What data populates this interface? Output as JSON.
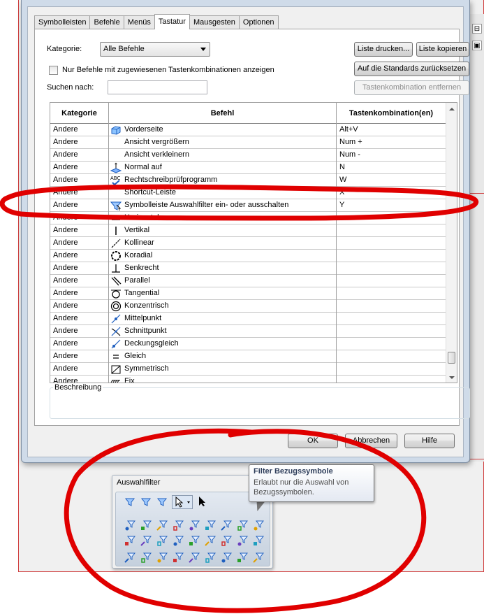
{
  "tabs": [
    {
      "label": "Symbolleisten"
    },
    {
      "label": "Befehle"
    },
    {
      "label": "Menüs"
    },
    {
      "label": "Tastatur"
    },
    {
      "label": "Mausgesten"
    },
    {
      "label": "Optionen"
    }
  ],
  "active_tab": "Tastatur",
  "filters": {
    "category_label": "Kategorie:",
    "category_value": "Alle Befehle",
    "only_assigned_label": "Nur Befehle mit zugewiesenen Tastenkombinationen anzeigen",
    "search_label": "Suchen nach:",
    "search_value": ""
  },
  "buttons": {
    "print_list": "Liste drucken...",
    "copy_list": "Liste kopieren",
    "reset_defaults": "Auf die Standards zurücksetzen",
    "remove_shortcut": "Tastenkombination entfernen",
    "ok": "OK",
    "cancel": "Abbrechen",
    "help": "Hilfe"
  },
  "table": {
    "headers": [
      "Kategorie",
      "Befehl",
      "Tastenkombination(en)"
    ],
    "rows": [
      {
        "category": "Andere",
        "command": "Vorderseite",
        "shortcut": "Alt+V",
        "icon": "front-view-icon"
      },
      {
        "category": "Andere",
        "command": "Ansicht vergrößern",
        "shortcut": "Num +",
        "icon": ""
      },
      {
        "category": "Andere",
        "command": "Ansicht verkleinern",
        "shortcut": "Num -",
        "icon": ""
      },
      {
        "category": "Andere",
        "command": "Normal auf",
        "shortcut": "N",
        "icon": "normal-to-icon"
      },
      {
        "category": "Andere",
        "command": "Rechtschreibprüfprogramm",
        "shortcut": "W",
        "icon": "spell-check-icon"
      },
      {
        "category": "Andere",
        "command": "Shortcut-Leiste",
        "shortcut": "X",
        "icon": ""
      },
      {
        "category": "Andere",
        "command": "Symbolleiste Auswahlfilter ein- oder ausschalten",
        "shortcut": "Y",
        "icon": "selection-filter-icon"
      },
      {
        "category": "Andere",
        "command": "Horizontal",
        "shortcut": "",
        "icon": "horizontal-icon"
      },
      {
        "category": "Andere",
        "command": "Vertikal",
        "shortcut": "",
        "icon": "vertical-icon"
      },
      {
        "category": "Andere",
        "command": "Kollinear",
        "shortcut": "",
        "icon": "collinear-icon"
      },
      {
        "category": "Andere",
        "command": "Koradial",
        "shortcut": "",
        "icon": "coradial-icon"
      },
      {
        "category": "Andere",
        "command": "Senkrecht",
        "shortcut": "",
        "icon": "perpendicular-icon"
      },
      {
        "category": "Andere",
        "command": "Parallel",
        "shortcut": "",
        "icon": "parallel-icon"
      },
      {
        "category": "Andere",
        "command": "Tangential",
        "shortcut": "",
        "icon": "tangent-icon"
      },
      {
        "category": "Andere",
        "command": "Konzentrisch",
        "shortcut": "",
        "icon": "concentric-icon"
      },
      {
        "category": "Andere",
        "command": "Mittelpunkt",
        "shortcut": "",
        "icon": "midpoint-icon"
      },
      {
        "category": "Andere",
        "command": "Schnittpunkt",
        "shortcut": "",
        "icon": "intersection-icon"
      },
      {
        "category": "Andere",
        "command": "Deckungsgleich",
        "shortcut": "",
        "icon": "coincident-icon"
      },
      {
        "category": "Andere",
        "command": "Gleich",
        "shortcut": "",
        "icon": "equal-icon"
      },
      {
        "category": "Andere",
        "command": "Symmetrisch",
        "shortcut": "",
        "icon": "symmetric-icon"
      },
      {
        "category": "Andere",
        "command": "Fix",
        "shortcut": "",
        "icon": "fix-icon"
      }
    ]
  },
  "description": {
    "label": "Beschreibung",
    "text": ""
  },
  "toolbar": {
    "title": "Auswahlfilter"
  },
  "tooltip": {
    "title": "Filter Bezugssymbole",
    "text": "Erlaubt nur die Auswahl von Bezugssymbolen."
  },
  "colors": {
    "accent": "#2b6fd6",
    "annotation_red": "#e00000",
    "dialog_frame": "#cfdbe9"
  }
}
